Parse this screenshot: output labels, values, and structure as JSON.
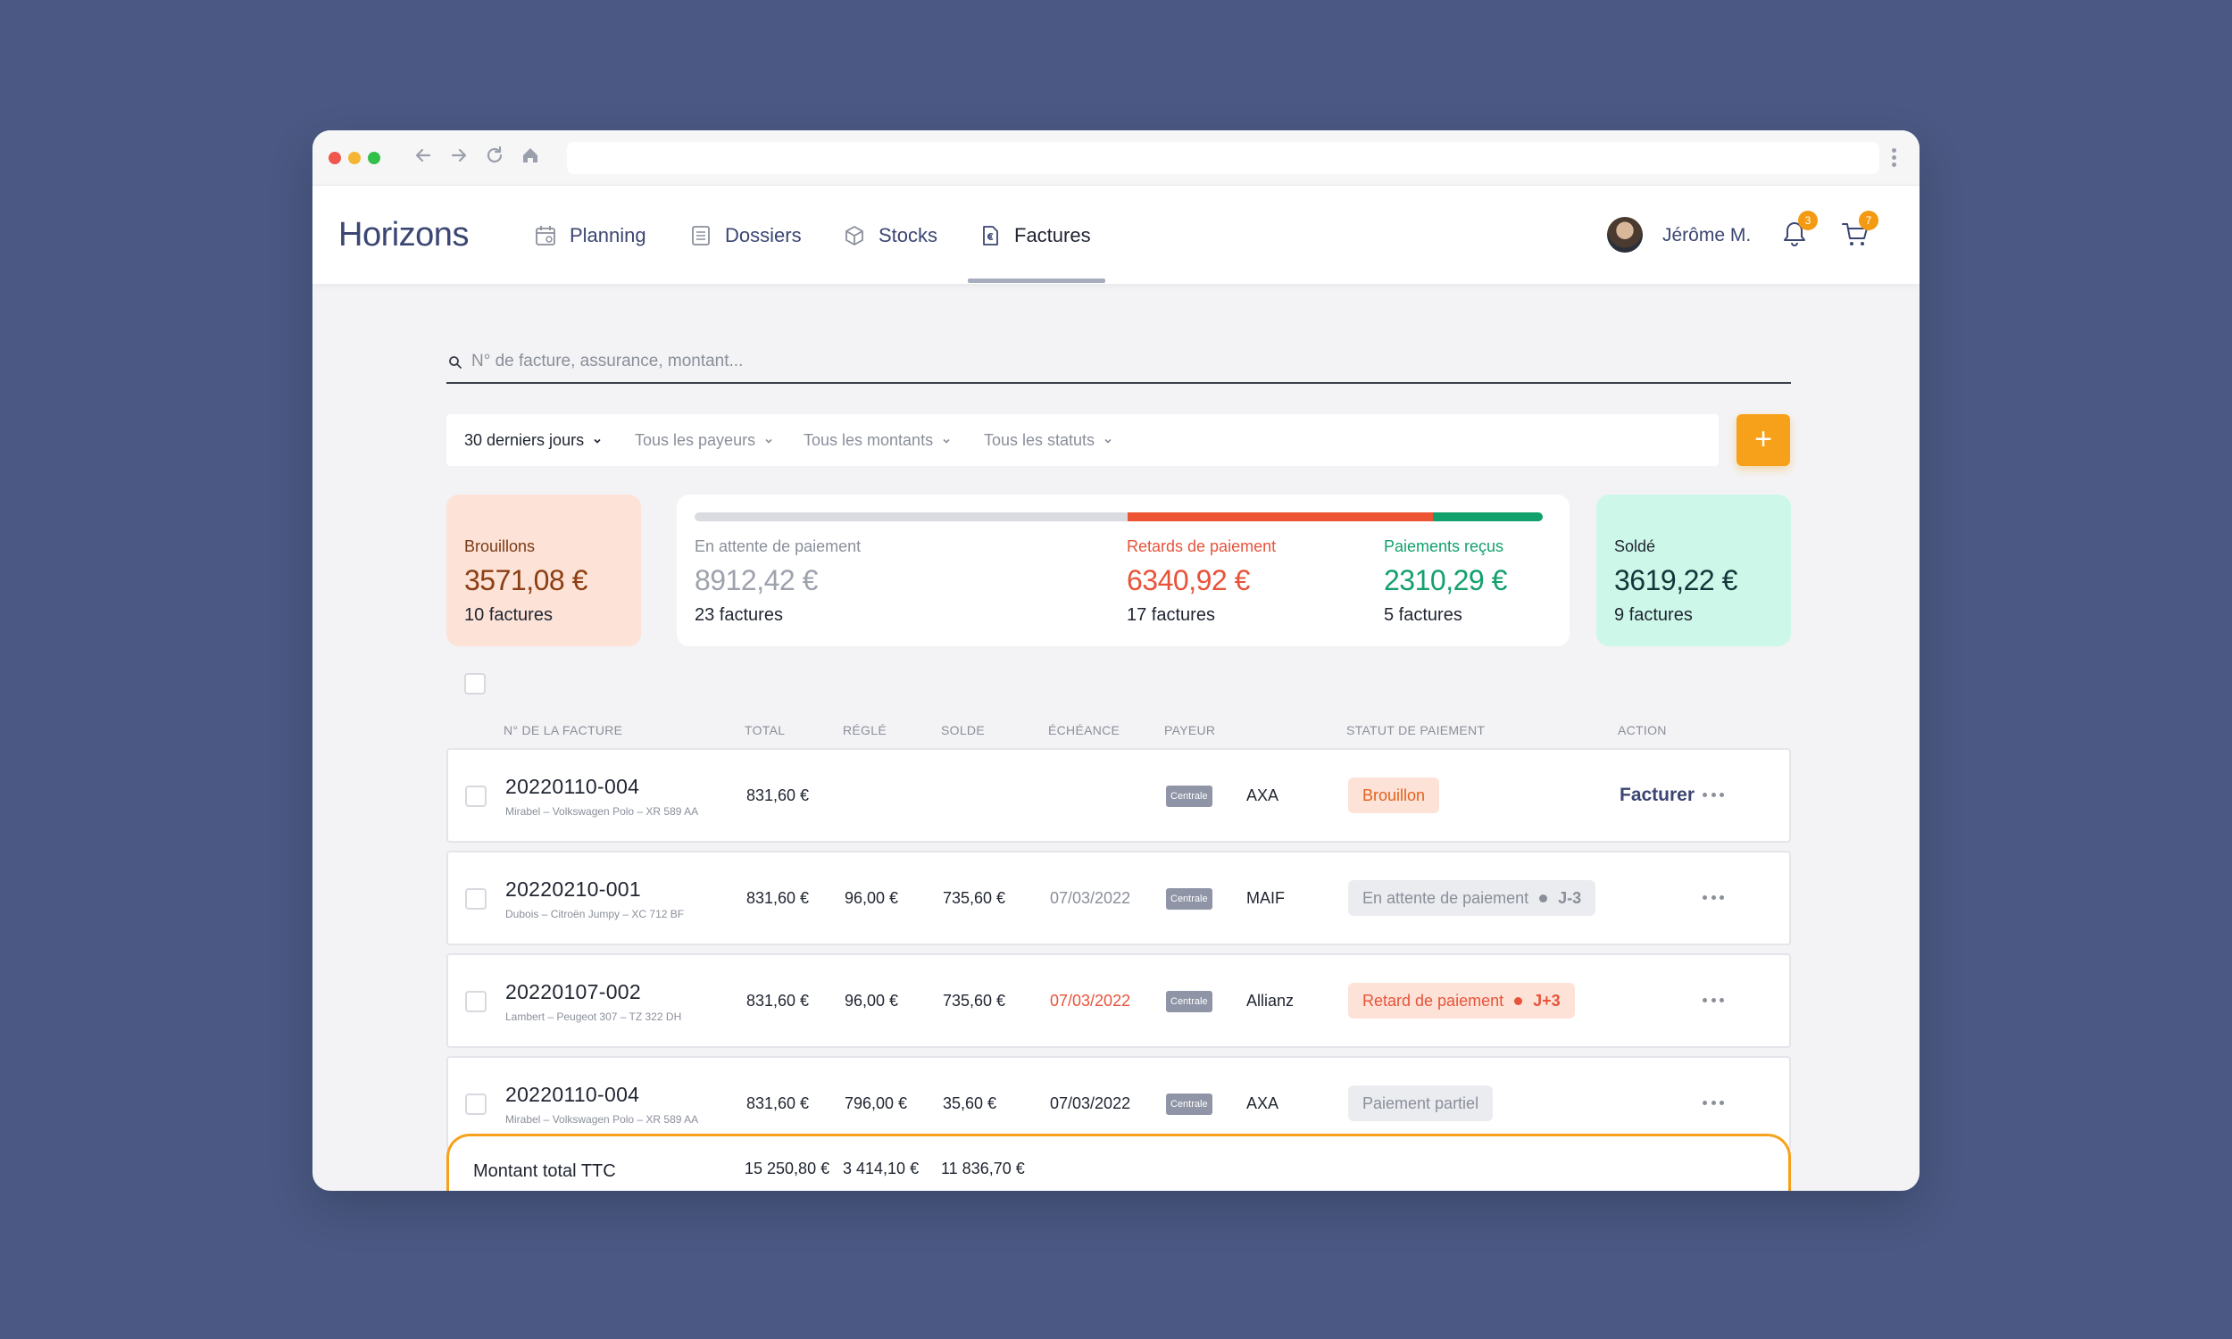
{
  "app": {
    "name": "Horizons"
  },
  "nav": {
    "items": [
      {
        "label": "Planning"
      },
      {
        "label": "Dossiers"
      },
      {
        "label": "Stocks"
      },
      {
        "label": "Factures"
      }
    ],
    "active": "Factures"
  },
  "user": {
    "name": "Jérôme M.",
    "notifications_count": "3",
    "cart_count": "7"
  },
  "search": {
    "placeholder": "N° de facture, assurance, montant..."
  },
  "filters": [
    {
      "label": "30 derniers jours"
    },
    {
      "label": "Tous les payeurs"
    },
    {
      "label": "Tous les montants"
    },
    {
      "label": "Tous les statuts"
    }
  ],
  "add_button": {
    "label": "+"
  },
  "summary": {
    "drafts": {
      "label": "Brouillons",
      "amount": "3571,08 €",
      "count": "10 factures"
    },
    "pending": {
      "label": "En attente de paiement",
      "amount": "8912,42 €",
      "count": "23 factures"
    },
    "late": {
      "label": "Retards de paiement",
      "amount": "6340,92 €",
      "count": "17 factures"
    },
    "received": {
      "label": "Paiements reçus",
      "amount": "2310,29 €",
      "count": "5 factures"
    },
    "paid": {
      "label": "Soldé",
      "amount": "3619,22 €",
      "count": "9 factures"
    },
    "progress_shares": {
      "pending": 0.51,
      "late": 0.36,
      "received": 0.13
    },
    "colors": {
      "pending": "#d9dbe1",
      "late": "#ec5433",
      "received": "#12a06d"
    }
  },
  "table": {
    "headers": {
      "number": "N° DE LA FACTURE",
      "total": "TOTAL",
      "settled": "RÉGLÉ",
      "balance": "SOLDE",
      "due": "ÉCHÉANCE",
      "payer": "PAYEUR",
      "status": "STATUT DE PAIEMENT",
      "action": "ACTION"
    },
    "rows": [
      {
        "number": "20220110-004",
        "desc": "Mirabel – Volkswagen Polo – XR 589 AA",
        "total": "831,60 €",
        "settled": "",
        "balance": "",
        "due": "",
        "tag": "Centrale",
        "payer": "AXA",
        "status": "Brouillon",
        "status_delay": "",
        "action": "Facturer"
      },
      {
        "number": "20220210-001",
        "desc": "Dubois – Citroën Jumpy – XC 712 BF",
        "total": "831,60 €",
        "settled": "96,00 €",
        "balance": "735,60 €",
        "due": "07/03/2022",
        "tag": "Centrale",
        "payer": "MAIF",
        "status": "En attente de paiement",
        "status_delay": "J-3",
        "action": ""
      },
      {
        "number": "20220107-002",
        "desc": "Lambert – Peugeot 307 – TZ 322 DH",
        "total": "831,60 €",
        "settled": "96,00 €",
        "balance": "735,60 €",
        "due": "07/03/2022",
        "tag": "Centrale",
        "payer": "Allianz",
        "status": "Retard de paiement",
        "status_delay": "J+3",
        "action": ""
      },
      {
        "number": "20220110-004",
        "desc": "Mirabel – Volkswagen Polo – XR 589 AA",
        "total": "831,60 €",
        "settled": "796,00 €",
        "balance": "35,60 €",
        "due": "07/03/2022",
        "tag": "Centrale",
        "payer": "AXA",
        "status": "Paiement partiel",
        "status_delay": "",
        "action": ""
      }
    ]
  },
  "totals": {
    "label": "Montant total TTC",
    "total": "15 250,80 €",
    "settled": "3 414,10 €",
    "balance": "11 836,70 €"
  }
}
